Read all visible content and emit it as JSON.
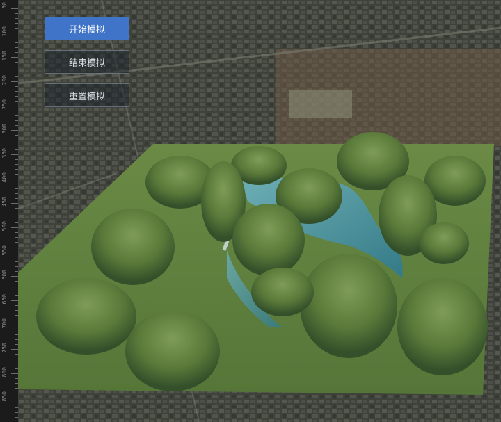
{
  "ruler": {
    "labels": [
      "50",
      "100",
      "150",
      "200",
      "250",
      "300",
      "350",
      "400",
      "450",
      "500",
      "550",
      "600",
      "650",
      "700",
      "750",
      "800",
      "850"
    ]
  },
  "controls": {
    "start_label": "开始模拟",
    "end_label": "结束模拟",
    "reset_label": "重置模拟",
    "active": "start"
  },
  "colors": {
    "terrain": "#5f7d3e",
    "water": "#3f8fa8",
    "accent": "#3f74c8"
  }
}
